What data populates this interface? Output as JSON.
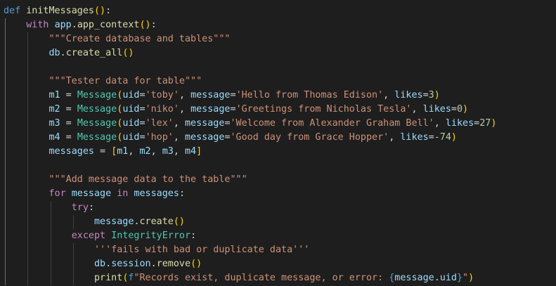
{
  "theme": {
    "background": "#1e1e1e",
    "token_colors": {
      "kw": "#569cd6",
      "ctrl": "#c586c0",
      "fn": "#dcdcaa",
      "var": "#9cdcfe",
      "cls": "#4ec9b0",
      "str": "#ce9178",
      "num": "#b5cea8",
      "plain": "#d4d4d4",
      "bracket1": "#ffd700",
      "bracket2": "#da70d6",
      "bracket3": "#179fff",
      "param": "#9cdcfe",
      "op": "#d4d4d4"
    }
  },
  "code": {
    "lines": [
      {
        "indent": 0,
        "tokens": [
          {
            "t": "def",
            "c": "kw"
          },
          {
            "t": " ",
            "c": "plain"
          },
          {
            "t": "initMessages",
            "c": "fn"
          },
          {
            "t": "()",
            "c": "bracket1"
          },
          {
            "t": ":",
            "c": "plain"
          }
        ]
      },
      {
        "indent": 1,
        "tokens": [
          {
            "t": "with",
            "c": "ctrl"
          },
          {
            "t": " ",
            "c": "plain"
          },
          {
            "t": "app",
            "c": "var"
          },
          {
            "t": ".",
            "c": "plain"
          },
          {
            "t": "app_context",
            "c": "fn"
          },
          {
            "t": "()",
            "c": "bracket1"
          },
          {
            "t": ":",
            "c": "plain"
          }
        ]
      },
      {
        "indent": 2,
        "tokens": [
          {
            "t": "\"\"\"Create database and tables\"\"\"",
            "c": "str"
          }
        ]
      },
      {
        "indent": 2,
        "tokens": [
          {
            "t": "db",
            "c": "var"
          },
          {
            "t": ".",
            "c": "plain"
          },
          {
            "t": "create_all",
            "c": "fn"
          },
          {
            "t": "()",
            "c": "bracket1"
          }
        ]
      },
      {
        "indent": 0,
        "tokens": []
      },
      {
        "indent": 2,
        "tokens": [
          {
            "t": "\"\"\"Tester data for table\"\"\"",
            "c": "str"
          }
        ]
      },
      {
        "indent": 2,
        "tokens": [
          {
            "t": "m1",
            "c": "var"
          },
          {
            "t": " = ",
            "c": "op"
          },
          {
            "t": "Message",
            "c": "cls"
          },
          {
            "t": "(",
            "c": "bracket1"
          },
          {
            "t": "uid",
            "c": "param"
          },
          {
            "t": "=",
            "c": "op"
          },
          {
            "t": "'toby'",
            "c": "str"
          },
          {
            "t": ", ",
            "c": "plain"
          },
          {
            "t": "message",
            "c": "param"
          },
          {
            "t": "=",
            "c": "op"
          },
          {
            "t": "'Hello from Thomas Edison'",
            "c": "str"
          },
          {
            "t": ", ",
            "c": "plain"
          },
          {
            "t": "likes",
            "c": "param"
          },
          {
            "t": "=",
            "c": "op"
          },
          {
            "t": "3",
            "c": "num"
          },
          {
            "t": ")",
            "c": "bracket1"
          }
        ]
      },
      {
        "indent": 2,
        "tokens": [
          {
            "t": "m2",
            "c": "var"
          },
          {
            "t": " = ",
            "c": "op"
          },
          {
            "t": "Message",
            "c": "cls"
          },
          {
            "t": "(",
            "c": "bracket1"
          },
          {
            "t": "uid",
            "c": "param"
          },
          {
            "t": "=",
            "c": "op"
          },
          {
            "t": "'niko'",
            "c": "str"
          },
          {
            "t": ", ",
            "c": "plain"
          },
          {
            "t": "message",
            "c": "param"
          },
          {
            "t": "=",
            "c": "op"
          },
          {
            "t": "'Greetings from Nicholas Tesla'",
            "c": "str"
          },
          {
            "t": ", ",
            "c": "plain"
          },
          {
            "t": "likes",
            "c": "param"
          },
          {
            "t": "=",
            "c": "op"
          },
          {
            "t": "0",
            "c": "num"
          },
          {
            "t": ")",
            "c": "bracket1"
          }
        ]
      },
      {
        "indent": 2,
        "tokens": [
          {
            "t": "m3",
            "c": "var"
          },
          {
            "t": " = ",
            "c": "op"
          },
          {
            "t": "Message",
            "c": "cls"
          },
          {
            "t": "(",
            "c": "bracket1"
          },
          {
            "t": "uid",
            "c": "param"
          },
          {
            "t": "=",
            "c": "op"
          },
          {
            "t": "'lex'",
            "c": "str"
          },
          {
            "t": ", ",
            "c": "plain"
          },
          {
            "t": "message",
            "c": "param"
          },
          {
            "t": "=",
            "c": "op"
          },
          {
            "t": "'Welcome from Alexander Graham Bell'",
            "c": "str"
          },
          {
            "t": ", ",
            "c": "plain"
          },
          {
            "t": "likes",
            "c": "param"
          },
          {
            "t": "=",
            "c": "op"
          },
          {
            "t": "27",
            "c": "num"
          },
          {
            "t": ")",
            "c": "bracket1"
          }
        ]
      },
      {
        "indent": 2,
        "tokens": [
          {
            "t": "m4",
            "c": "var"
          },
          {
            "t": " = ",
            "c": "op"
          },
          {
            "t": "Message",
            "c": "cls"
          },
          {
            "t": "(",
            "c": "bracket1"
          },
          {
            "t": "uid",
            "c": "param"
          },
          {
            "t": "=",
            "c": "op"
          },
          {
            "t": "'hop'",
            "c": "str"
          },
          {
            "t": ", ",
            "c": "plain"
          },
          {
            "t": "message",
            "c": "param"
          },
          {
            "t": "=",
            "c": "op"
          },
          {
            "t": "'Good day from Grace Hopper'",
            "c": "str"
          },
          {
            "t": ", ",
            "c": "plain"
          },
          {
            "t": "likes",
            "c": "param"
          },
          {
            "t": "=",
            "c": "op"
          },
          {
            "t": "-74",
            "c": "num"
          },
          {
            "t": ")",
            "c": "bracket1"
          }
        ]
      },
      {
        "indent": 2,
        "tokens": [
          {
            "t": "messages",
            "c": "var"
          },
          {
            "t": " = ",
            "c": "op"
          },
          {
            "t": "[",
            "c": "bracket1"
          },
          {
            "t": "m1",
            "c": "var"
          },
          {
            "t": ", ",
            "c": "plain"
          },
          {
            "t": "m2",
            "c": "var"
          },
          {
            "t": ", ",
            "c": "plain"
          },
          {
            "t": "m3",
            "c": "var"
          },
          {
            "t": ", ",
            "c": "plain"
          },
          {
            "t": "m4",
            "c": "var"
          },
          {
            "t": "]",
            "c": "bracket1"
          }
        ]
      },
      {
        "indent": 0,
        "tokens": []
      },
      {
        "indent": 2,
        "tokens": [
          {
            "t": "\"\"\"Add message data to the table\"\"\"",
            "c": "str"
          }
        ]
      },
      {
        "indent": 2,
        "tokens": [
          {
            "t": "for",
            "c": "ctrl"
          },
          {
            "t": " ",
            "c": "plain"
          },
          {
            "t": "message",
            "c": "var"
          },
          {
            "t": " ",
            "c": "plain"
          },
          {
            "t": "in",
            "c": "ctrl"
          },
          {
            "t": " ",
            "c": "plain"
          },
          {
            "t": "messages",
            "c": "var"
          },
          {
            "t": ":",
            "c": "plain"
          }
        ]
      },
      {
        "indent": 3,
        "tokens": [
          {
            "t": "try",
            "c": "ctrl"
          },
          {
            "t": ":",
            "c": "plain"
          }
        ]
      },
      {
        "indent": 4,
        "tokens": [
          {
            "t": "message",
            "c": "var"
          },
          {
            "t": ".",
            "c": "plain"
          },
          {
            "t": "create",
            "c": "fn"
          },
          {
            "t": "()",
            "c": "bracket1"
          }
        ]
      },
      {
        "indent": 3,
        "tokens": [
          {
            "t": "except",
            "c": "ctrl"
          },
          {
            "t": " ",
            "c": "plain"
          },
          {
            "t": "IntegrityError",
            "c": "cls"
          },
          {
            "t": ":",
            "c": "plain"
          }
        ]
      },
      {
        "indent": 4,
        "tokens": [
          {
            "t": "'''fails with bad or duplicate data'''",
            "c": "str"
          }
        ]
      },
      {
        "indent": 4,
        "tokens": [
          {
            "t": "db",
            "c": "var"
          },
          {
            "t": ".",
            "c": "plain"
          },
          {
            "t": "session",
            "c": "var"
          },
          {
            "t": ".",
            "c": "plain"
          },
          {
            "t": "remove",
            "c": "fn"
          },
          {
            "t": "()",
            "c": "bracket1"
          }
        ]
      },
      {
        "indent": 4,
        "tokens": [
          {
            "t": "print",
            "c": "fn"
          },
          {
            "t": "(",
            "c": "bracket1"
          },
          {
            "t": "f",
            "c": "kw"
          },
          {
            "t": "\"Records exist, duplicate message, or error: ",
            "c": "str"
          },
          {
            "t": "{",
            "c": "kw"
          },
          {
            "t": "message",
            "c": "var"
          },
          {
            "t": ".",
            "c": "plain"
          },
          {
            "t": "uid",
            "c": "var"
          },
          {
            "t": "}",
            "c": "kw"
          },
          {
            "t": "\"",
            "c": "str"
          },
          {
            "t": ")",
            "c": "bracket1"
          }
        ]
      }
    ]
  }
}
